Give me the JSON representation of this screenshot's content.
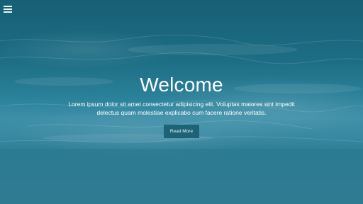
{
  "header": {
    "menu_icon": "hamburger-menu-icon"
  },
  "hero": {
    "title": "Welcome",
    "subtitle": "Lorem ipsum dolor sit amet consectetur adipisicing elit. Voluptas maiores sint impedit delectus quam molestiae explicabo cum facere ratione veritatis.",
    "cta_label": "Read More"
  },
  "colors": {
    "background": "#2b819a",
    "button": "#1d6277",
    "text": "#ffffff"
  }
}
